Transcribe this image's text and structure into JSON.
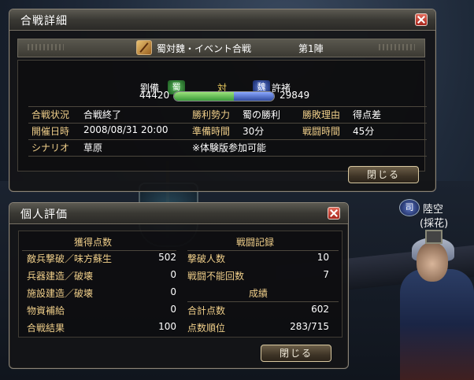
{
  "top_window": {
    "title": "合戦詳細",
    "close_label": "閉じる",
    "event": {
      "name": "蜀対魏・イベント合戦",
      "phase": "第1陣"
    },
    "shu": {
      "commander": "劉備",
      "badge": "蜀",
      "score": "44420"
    },
    "vs_label": "対",
    "wei": {
      "commander": "許褚",
      "badge": "魏",
      "score": "29849"
    },
    "score_ratio": 0.598,
    "rows": [
      {
        "l1": "合戦状況",
        "v1": "合戦終了",
        "l2": "勝利勢力",
        "v2": "蜀の勝利",
        "l3": "勝敗理由",
        "v3": "得点差"
      },
      {
        "l1": "開催日時",
        "v1": "2008/08/31 20:00",
        "l2": "準備時間",
        "v2": "30分",
        "l3": "戦闘時間",
        "v3": "45分"
      },
      {
        "l1": "シナリオ",
        "v1": "草原",
        "l2": "",
        "v2": "※体験版参加可能",
        "l3": "",
        "v3": ""
      }
    ]
  },
  "bottom_window": {
    "title": "個人評価",
    "close_label": "閉じる",
    "left_header": "獲得点数",
    "right_header": "戦闘記録",
    "result_header": "成績",
    "left_rows": [
      {
        "label": "敵兵撃破／味方蘇生",
        "value": "502"
      },
      {
        "label": "兵器建造／破壊",
        "value": "0"
      },
      {
        "label": "施設建造／破壊",
        "value": "0"
      },
      {
        "label": "物資補給",
        "value": "0"
      },
      {
        "label": "合戦結果",
        "value": "100"
      }
    ],
    "right_rows": [
      {
        "label": "撃破人数",
        "value": "10"
      },
      {
        "label": "戦闘不能回数",
        "value": "7"
      }
    ],
    "result_rows": [
      {
        "label": "合計点数",
        "value": "602"
      },
      {
        "label": "点数順位",
        "value": "283/715"
      }
    ]
  },
  "character": {
    "badge": "司",
    "name": "陸空",
    "title": "(採花)"
  }
}
